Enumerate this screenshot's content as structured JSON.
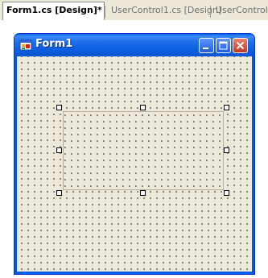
{
  "tabs": [
    {
      "label": "Form1.cs [Design]*",
      "active": true
    },
    {
      "label": "UserControl1.cs [Design]",
      "active": false
    },
    {
      "label": "UserControl1",
      "active": false
    }
  ],
  "form": {
    "title": "Form1",
    "icon": "form-app-icon",
    "controls": [
      "minimize-icon",
      "maximize-icon",
      "close-icon"
    ]
  },
  "colors": {
    "titlebar": "#0a55d6",
    "client": "#ece9d8",
    "close": "#c0391c"
  }
}
